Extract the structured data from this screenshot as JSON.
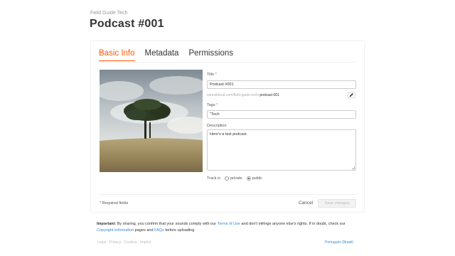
{
  "header": {
    "account": "Field Guide Tech",
    "title": "Podcast #001"
  },
  "tabs": [
    {
      "label": "Basic Info",
      "active": true
    },
    {
      "label": "Metadata",
      "active": false
    },
    {
      "label": "Permissions",
      "active": false
    }
  ],
  "form": {
    "title_label": "Title",
    "title_value": "Podcast #001",
    "permalink_prefix": "soundcloud.com/field-guide-tech/",
    "permalink_slug": "podcast-001",
    "tags_label": "Tags",
    "tags_value": "\"Tech",
    "description_label": "Description",
    "description_value": "Here's a test podcast.",
    "required_mark": "*",
    "track_is_label": "Track is",
    "privacy_options": [
      {
        "label": "private",
        "selected": false
      },
      {
        "label": "public",
        "selected": true
      }
    ]
  },
  "actions": {
    "required_note": "Required fields",
    "cancel_label": "Cancel",
    "save_label": "Save changes"
  },
  "legal": {
    "important": "Important:",
    "text1": " By sharing, you confirm that your sounds comply with our ",
    "terms_link": "Terms of Use",
    "text2": " and don't infringe anyone else's rights. If in doubt, check our ",
    "copyright_link": "Copyright information",
    "text3": " pages and ",
    "faqs_link": "FAQs",
    "text4": " before uploading."
  },
  "footer": {
    "links": [
      "Legal",
      "Privacy",
      "Cookies",
      "Imprint"
    ],
    "separator": " · ",
    "language": "Português (Brasil)"
  },
  "colors": {
    "accent": "#ff5500",
    "link": "#3388dd"
  },
  "icons": {
    "edit": "pencil-icon"
  }
}
